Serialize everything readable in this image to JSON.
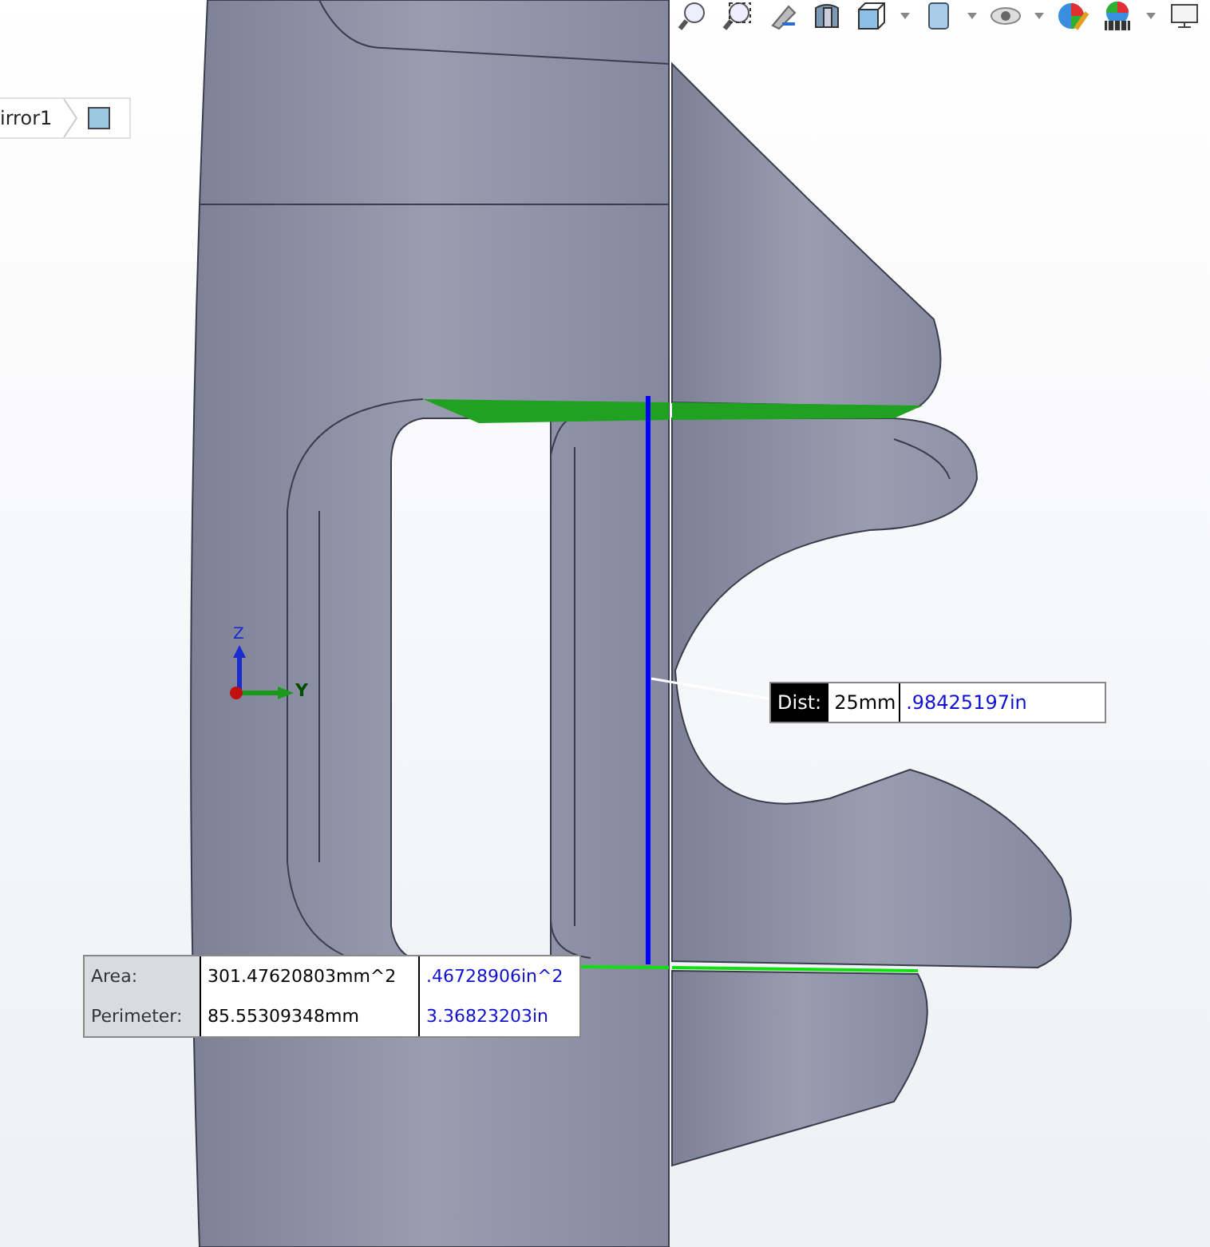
{
  "breadcrumb": {
    "text": "irror1"
  },
  "triad": {
    "z_label": "Z",
    "y_label": "Y"
  },
  "distance": {
    "label": "Dist:",
    "metric": "25mm",
    "imperial": ".98425197in"
  },
  "measure": {
    "rows": [
      {
        "label": "Area:",
        "metric": "301.47620803mm^2",
        "imperial": ".46728906in^2"
      },
      {
        "label": "Perimeter:",
        "metric": "85.55309348mm",
        "imperial": "3.36823203in"
      }
    ]
  }
}
